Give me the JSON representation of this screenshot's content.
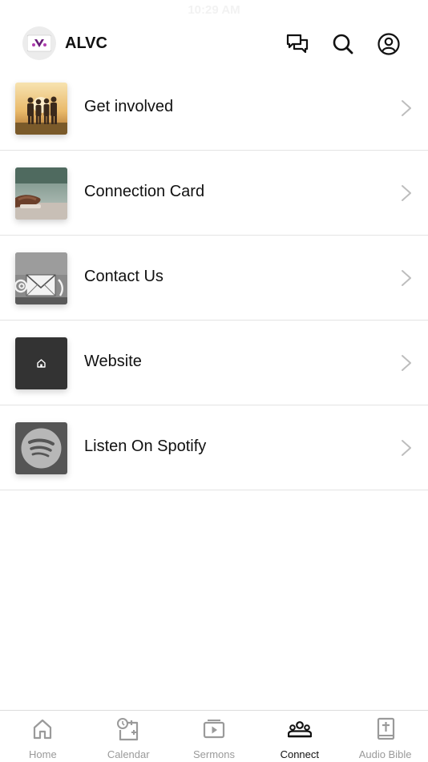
{
  "status_bar": {
    "time": "10:29 AM"
  },
  "header": {
    "title": "ALVC",
    "logo_text": "ALVC",
    "icons": [
      "chat-icon",
      "search-icon",
      "account-icon"
    ]
  },
  "menu": {
    "items": [
      {
        "label": "Get involved",
        "thumb": "people-sunset-photo"
      },
      {
        "label": "Connection Card",
        "thumb": "hands-nature-photo"
      },
      {
        "label": "Contact Us",
        "thumb": "mail-envelope-photo"
      },
      {
        "label": "Website",
        "thumb": "home-icon"
      },
      {
        "label": "Listen On Spotify",
        "thumb": "spotify-icon"
      }
    ]
  },
  "tabbar": {
    "active": "Connect",
    "tabs": [
      {
        "label": "Home",
        "icon": "home-icon"
      },
      {
        "label": "Calendar",
        "icon": "calendar-icon"
      },
      {
        "label": "Sermons",
        "icon": "play-icon"
      },
      {
        "label": "Connect",
        "icon": "group-icon"
      },
      {
        "label": "Audio Bible",
        "icon": "bible-icon"
      }
    ]
  },
  "colors": {
    "text": "#111111",
    "muted": "#9a9a9a",
    "divider": "#e3e3e3",
    "logo_purple": "#6a1f7a"
  }
}
